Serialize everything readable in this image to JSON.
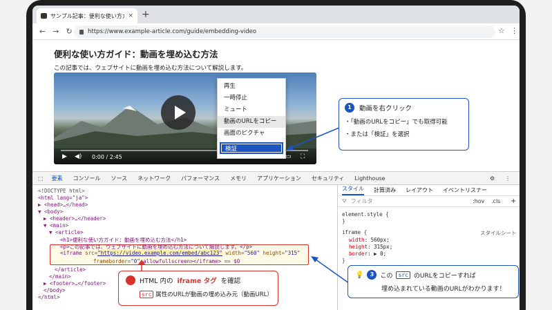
{
  "browser": {
    "tab_title": "サンプル記事：便利な使い方ガイド",
    "tab_close": "×",
    "new_tab": "+",
    "url": "https://www.example-article.com/guide/embedding-video",
    "nav_back": "←",
    "nav_forward": "→",
    "nav_reload": "↻",
    "star": "☆",
    "menu": "⋮"
  },
  "page": {
    "title": "便利な使い方ガイド：動画を埋め込む方法",
    "intro": "この記事では、ウェブサイトに動画を埋め込む方法について解説します。"
  },
  "video": {
    "time": "0:00 / 2:45"
  },
  "context_menu": {
    "items": [
      "再生",
      "一時停止",
      "ミュート",
      "動画のURLをコピー",
      "画面のピクチャ",
      "検証"
    ]
  },
  "callout1": {
    "number": "1",
    "title": "動画を右クリック",
    "bullets": [
      "・「動画のURLをコピー」でも取得可能",
      "・または「検証」を選択"
    ]
  },
  "devtools": {
    "tabs": [
      "要素",
      "コンソール",
      "ソース",
      "ネットワーク",
      "パフォーマンス",
      "メモリ",
      "アプリケーション",
      "セキュリティ",
      "Lighthouse"
    ],
    "elements": {
      "doctype": "<!DOCTYPE html>",
      "html_open": "<html lang=\"ja\">",
      "head": "▶ <head>…</head>",
      "body_open": "▼ <body>",
      "header": "▶ <header>…</header>",
      "main_open": "▼ <main>",
      "article_open": "▼ <article>",
      "h1": "<h1>便利な使い方ガイド：動画を埋め込む方法</h1>",
      "p": "<p>この記事では、ウェブサイトに動画を埋め込む方法について解説します。</p>",
      "iframe_tag": "<iframe",
      "src_attr": "src=",
      "src_val": "\"https://video.example.com/embed/abc123\"",
      "width_attr": "width=",
      "width_val": "\"560\"",
      "height_attr": "height=",
      "height_val": "\"315\"",
      "iframe_line2_attr": "frameborder=",
      "iframe_line2_val": "\"0\"",
      "iframe_line2_tail": "allowfullscreen></iframe> == $0",
      "article_close": "</article>",
      "main_close": "</main>",
      "footer": "▶ <footer>…</footer>",
      "body_close": "</body>",
      "html_close": "</html>"
    },
    "side_tabs": [
      "スタイル",
      "計算済み",
      "レイアウト",
      "イベントリスナー"
    ],
    "filter_placeholder": "フィルタ",
    "hov": ":hov",
    "cls": ".cls",
    "plus": "+",
    "element_style": "element.style {",
    "close_brace": "}",
    "iframe_rule": "iframe {",
    "stylesheet_label": "スタイルシート",
    "rules": [
      {
        "prop": "width",
        "val": "560px;"
      },
      {
        "prop": "height",
        "val": "315px;"
      },
      {
        "prop": "border",
        "val": "▶ 0;"
      }
    ]
  },
  "callout2": {
    "number": "2",
    "title_pre": "HTML 内の",
    "title_em": "iframe タグ",
    "title_post": "を確認",
    "chip": "src",
    "desc": "属性のURLが動画の埋め込み元（動画URL）"
  },
  "callout3": {
    "number": "3",
    "line1_pre": "この",
    "chip": "src",
    "line1_post": "のURLをコピーすれば",
    "line2": "埋め込まれている動画のURLがわかります！"
  },
  "colors": {
    "accent_blue": "#1a55c2",
    "accent_red": "#d9322a"
  }
}
